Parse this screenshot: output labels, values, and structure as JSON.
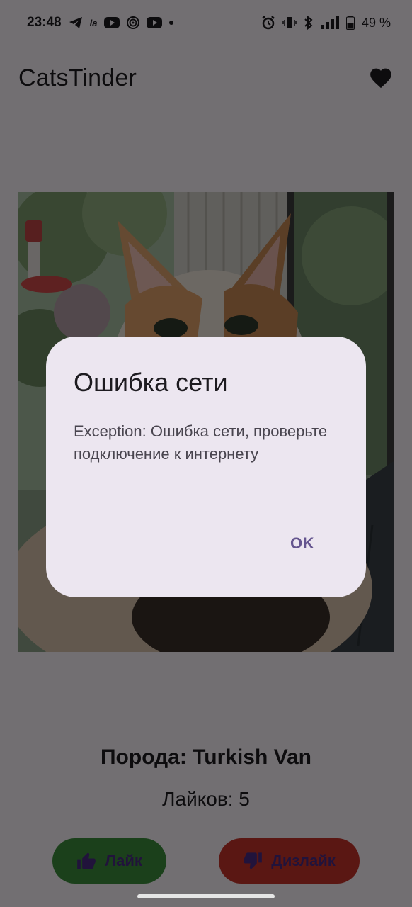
{
  "status_bar": {
    "time": "23:48",
    "battery": "49 %",
    "icons": [
      "telegram-icon",
      "la-icon",
      "youtube-icon",
      "spiral-icon",
      "youtube-icon",
      "dot-icon",
      "alarm-icon",
      "vibrate-icon",
      "bluetooth-icon",
      "signal-icon",
      "battery-icon"
    ],
    "la_text": "la"
  },
  "app_bar": {
    "title": "CatsTinder",
    "favorite_icon": "heart-icon"
  },
  "card": {
    "breed": "Порода: Turkish Van",
    "likes": "Лайков: 5"
  },
  "actions": {
    "like_label": "Лайк",
    "like_icon": "thumbs-up-icon",
    "dislike_label": "Дизлайк",
    "dislike_icon": "thumbs-down-icon"
  },
  "dialog": {
    "title": "Ошибка сети",
    "message": "Exception: Ошибка сети, проверьте подключение к интернету",
    "ok_label": "OK"
  },
  "colors": {
    "like": "#3c8f3c",
    "dislike": "#c8332c",
    "dialog_bg": "#ece6f0",
    "accent": "#65558f"
  }
}
